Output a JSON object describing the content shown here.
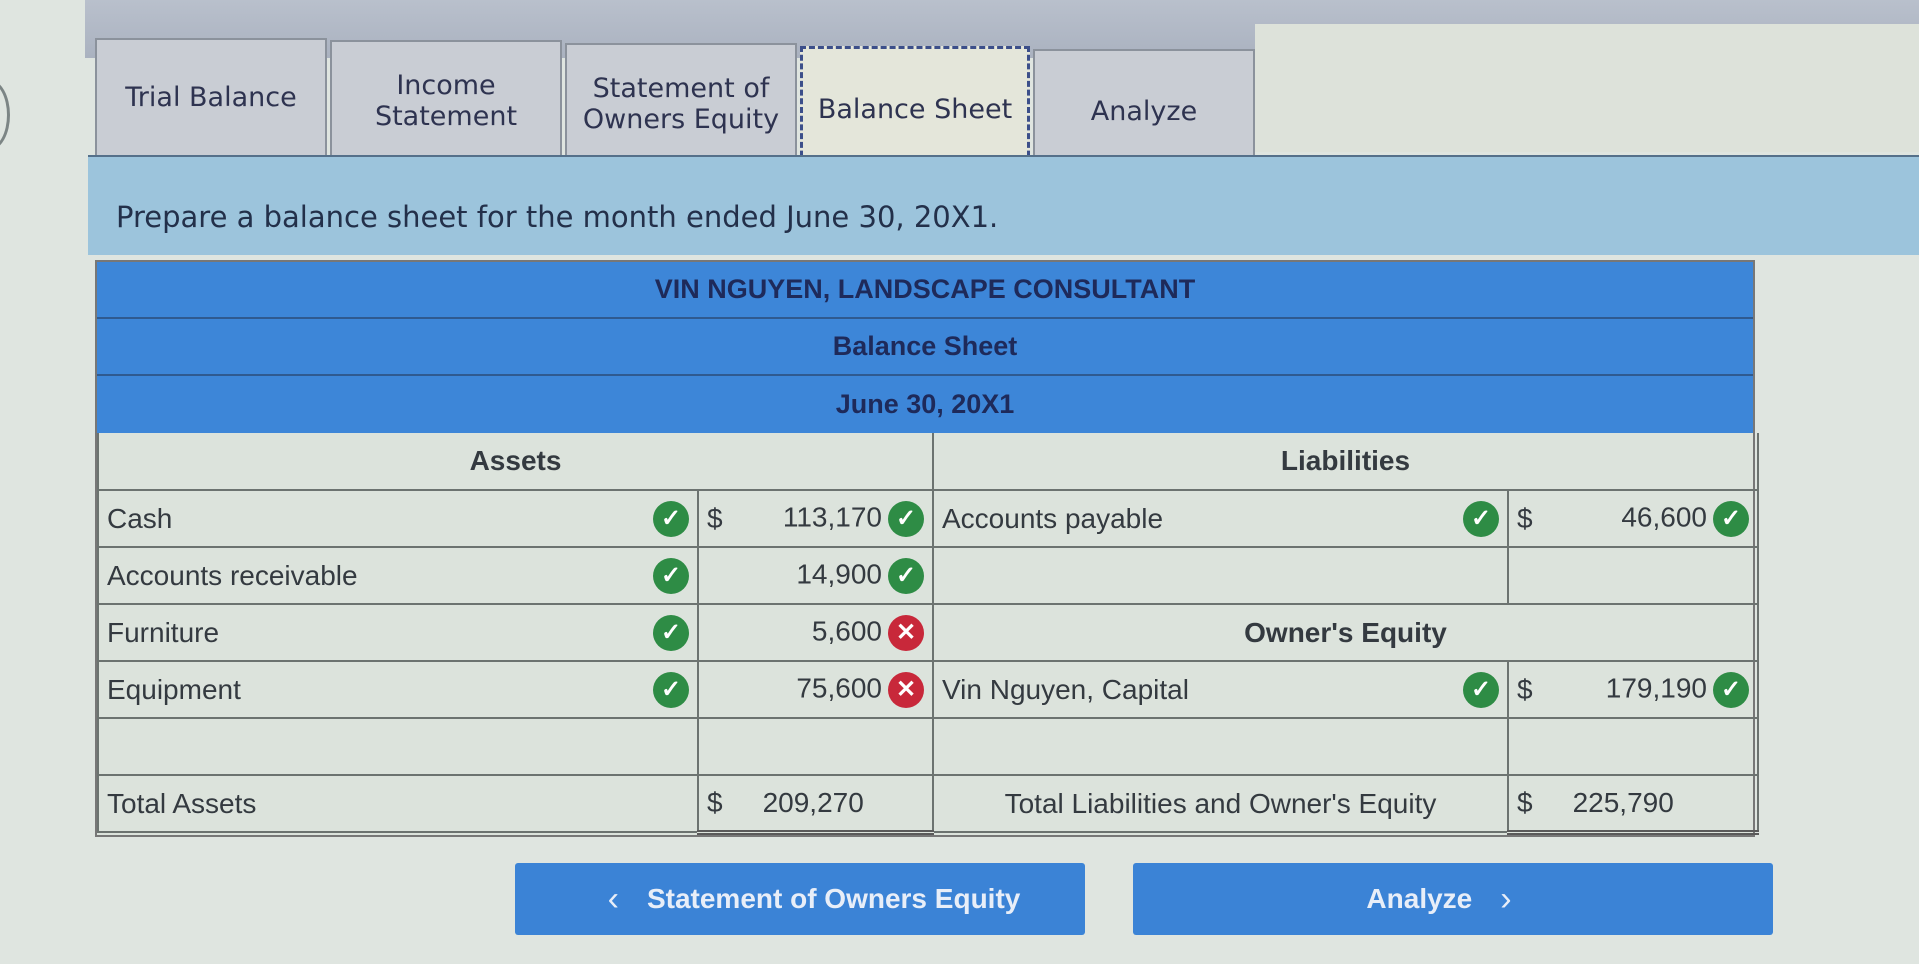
{
  "tabs": [
    {
      "label": "Trial Balance",
      "active": false
    },
    {
      "label": "Income Statement",
      "active": false
    },
    {
      "label": "Statement of Owners Equity",
      "active": false
    },
    {
      "label": "Balance Sheet",
      "active": true
    },
    {
      "label": "Analyze",
      "active": false
    }
  ],
  "instruction": "Prepare a balance sheet for the month ended June 30, 20X1.",
  "header": {
    "company": "VIN NGUYEN,  LANDSCAPE CONSULTANT",
    "statement": "Balance Sheet",
    "date": "June 30, 20X1"
  },
  "assets": {
    "title": "Assets",
    "rows": [
      {
        "label": "Cash",
        "label_status": "correct",
        "dollar": "$",
        "amount": "113,170",
        "amount_status": "correct"
      },
      {
        "label": "Accounts receivable",
        "label_status": "correct",
        "dollar": "",
        "amount": "14,900",
        "amount_status": "correct"
      },
      {
        "label": "Furniture",
        "label_status": "correct",
        "dollar": "",
        "amount": "5,600",
        "amount_status": "incorrect"
      },
      {
        "label": "Equipment",
        "label_status": "correct",
        "dollar": "",
        "amount": "75,600",
        "amount_status": "incorrect"
      }
    ],
    "total_label": "Total Assets",
    "total_dollar": "$",
    "total_amount": "209,270"
  },
  "liabilities": {
    "title": "Liabilities",
    "rows": [
      {
        "label": "Accounts payable",
        "label_status": "correct",
        "dollar": "$",
        "amount": "46,600",
        "amount_status": "correct"
      }
    ]
  },
  "equity": {
    "title": "Owner's Equity",
    "rows": [
      {
        "label": "Vin Nguyen, Capital",
        "label_status": "correct",
        "dollar": "$",
        "amount": "179,190",
        "amount_status": "correct"
      }
    ],
    "total_label": "Total Liabilities and Owner's Equity",
    "total_dollar": "$",
    "total_amount": "225,790"
  },
  "icons": {
    "correct": "✓",
    "incorrect": "✕",
    "prev": "‹",
    "next": "›"
  },
  "nav": {
    "prev_label": "Statement of Owners Equity",
    "next_label": "Analyze"
  },
  "colors": {
    "header_blue": "#3d86d8",
    "correct_green": "#2e8c45",
    "incorrect_red": "#c8283a",
    "button_blue": "#3b83d6"
  }
}
